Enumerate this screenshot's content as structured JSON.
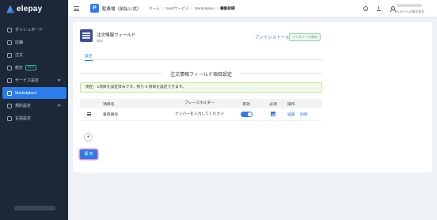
{
  "brand": {
    "name": "elepay"
  },
  "sidebar": {
    "items": [
      {
        "label": "ダッシュボード",
        "icon": "dashboard-icon"
      },
      {
        "label": "店舗",
        "icon": "store-icon"
      },
      {
        "label": "注文",
        "icon": "order-icon"
      },
      {
        "label": "統計",
        "icon": "stats-icon",
        "badge": "NEW"
      },
      {
        "label": "サービス設定",
        "icon": "service-icon"
      },
      {
        "label": "Marketplace",
        "icon": "marketplace-icon"
      },
      {
        "label": "規約設定",
        "icon": "terms-icon"
      },
      {
        "label": "言語設定",
        "icon": "language-icon"
      }
    ]
  },
  "header": {
    "app_icon_letter": "P",
    "store_name": "駐車場（前払い式）",
    "breadcrumb": [
      "ホーム",
      "SaaSサービス",
      "Marketplace",
      "機能詳細"
    ],
    "company": "ELESTYLE株式会社"
  },
  "app": {
    "title": "注文情報フィールド",
    "subtitle": "無料",
    "uninstall_label": "アンインストール",
    "status_label": "インストール済み"
  },
  "tabs": [
    {
      "label": "設定"
    }
  ],
  "section": {
    "title": "注文情報フィールド項目設定",
    "notice": "現在：1項目を設定済みです。残り 9 項目を設定できます。"
  },
  "table": {
    "headers": [
      "",
      "項目名",
      "プレースホルダー",
      "有効",
      "必須",
      "操作"
    ],
    "rows": [
      {
        "name": "車両番号",
        "placeholder": "ナンバーを入力してください",
        "enabled": true,
        "required": true,
        "actions": [
          "編集",
          "削除"
        ]
      }
    ]
  },
  "add_label": "+",
  "save_label": "保 存",
  "colors": {
    "sidebar": "#1c2837",
    "accent": "#2b7de9",
    "success": "#39a85b"
  }
}
